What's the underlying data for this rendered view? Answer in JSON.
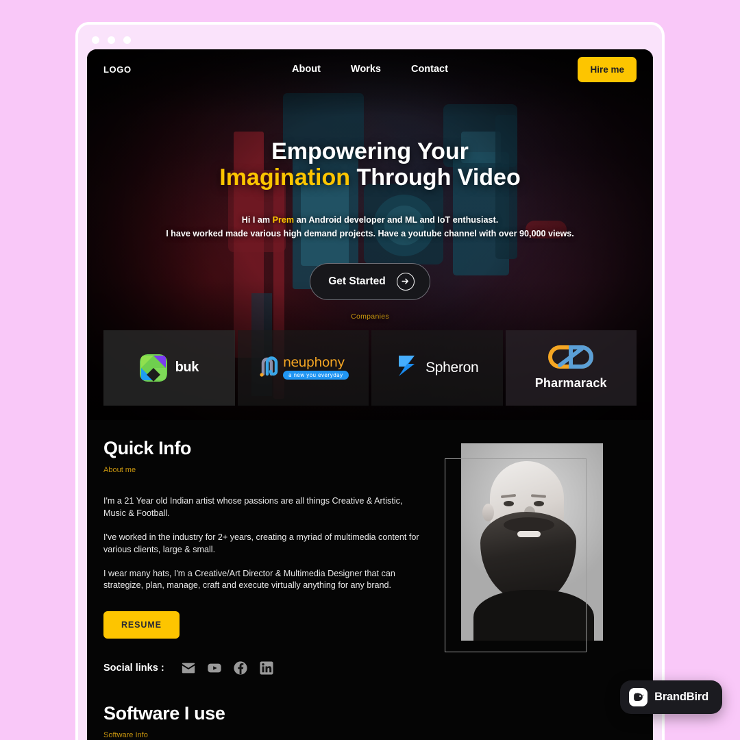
{
  "window": {
    "dots": [
      "dot-1",
      "dot-2",
      "dot-3"
    ],
    "chrome_color": "#fae3fb",
    "background_color": "#f9c8f8"
  },
  "nav": {
    "logo": "LOGO",
    "links": [
      {
        "label": "About"
      },
      {
        "label": "Works"
      },
      {
        "label": "Contact"
      }
    ],
    "cta_label": "Hire me",
    "cta_color": "#FDC500"
  },
  "hero": {
    "heading_line1": "Empowering Your",
    "heading_highlight": "Imagination",
    "heading_line2_rest": " Through Video",
    "sub_pre": "Hi I am ",
    "sub_name": "Prem",
    "sub_post": " an Android developer and ML and IoT enthusiast.",
    "sub_line2": "I have worked made various high demand projects. Have a youtube channel with over 90,000 views.",
    "cta_label": "Get Started",
    "cta_icon": "arrow-right-icon",
    "companies_label": "Companies"
  },
  "companies": [
    {
      "name": "buk",
      "logo": "buk-logo"
    },
    {
      "name": "neuphony",
      "tagline": "a new you everyday",
      "logo": "neuphony-logo"
    },
    {
      "name": "Spheron",
      "logo": "spheron-logo"
    },
    {
      "name": "Pharmarack",
      "logo": "pharmarack-logo"
    }
  ],
  "quick_info": {
    "title": "Quick Info",
    "kicker": "About me",
    "paragraphs": [
      "I'm a 21 Year old Indian artist whose passions are all things Creative & Artistic, Music & Football.",
      "I've worked in the industry for 2+ years, creating a myriad of multimedia content for various clients, large & small.",
      "I wear many hats, I'm a Creative/Art Director & Multimedia Designer that can strategize, plan, manage, craft and execute virtually anything for any brand."
    ],
    "resume_label": "RESUME",
    "social_label": "Social links :",
    "social_icons": [
      "email-icon",
      "youtube-icon",
      "facebook-icon",
      "linkedin-icon"
    ]
  },
  "software": {
    "title": "Software I use",
    "kicker": "Software Info"
  },
  "watermark": {
    "label": "BrandBird",
    "icon": "brandbird-logo-icon"
  },
  "colors": {
    "accent_gold": "#FDC500",
    "kicker_gold": "#c9960f",
    "page_background": "#050505"
  }
}
